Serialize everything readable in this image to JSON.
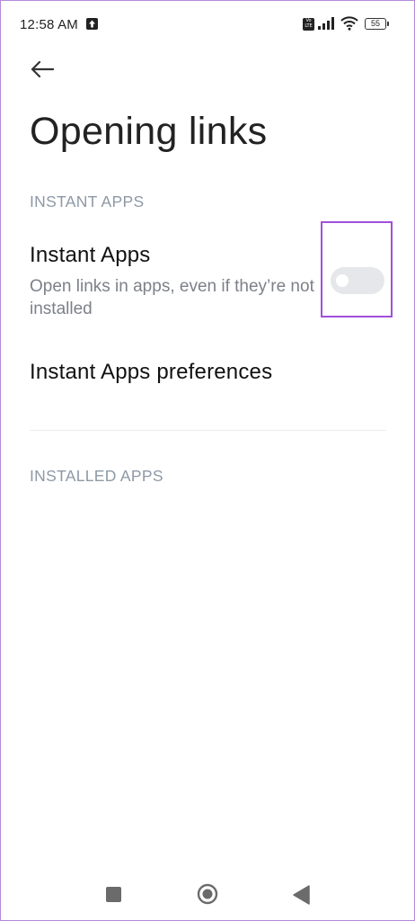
{
  "status_bar": {
    "time": "12:58 AM",
    "battery": "55"
  },
  "header": {
    "title": "Opening links"
  },
  "sections": {
    "instant_apps": "INSTANT APPS",
    "installed_apps": "INSTALLED APPS"
  },
  "instant_apps_item": {
    "title": "Instant Apps",
    "summary": "Open links in apps, even if they’re not installed",
    "toggle_on": false
  },
  "instant_apps_preferences": {
    "title": "Instant Apps preferences"
  },
  "colors": {
    "highlight": "#a14fdc",
    "section_header": "#8d99a6",
    "toggle_off": "#e6e7ea"
  }
}
